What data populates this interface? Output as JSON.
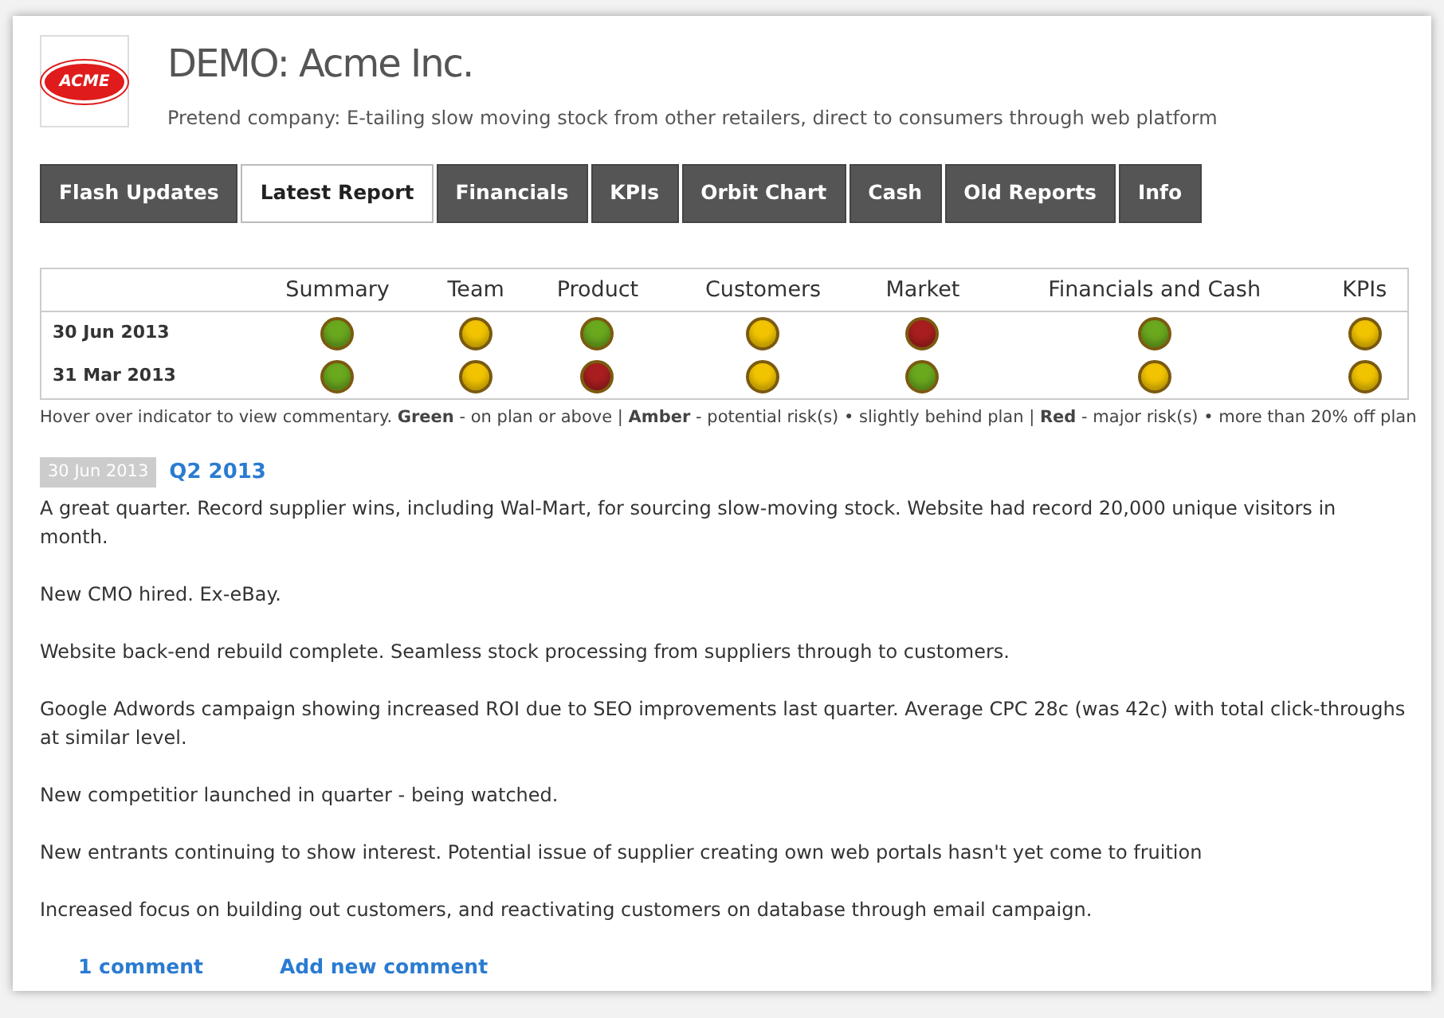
{
  "company": {
    "logo_text": "ACME",
    "title": "DEMO: Acme Inc.",
    "description": "Pretend company: E-tailing slow moving stock from other retailers, direct to consumers through web platform"
  },
  "tabs": [
    {
      "label": "Flash Updates",
      "selected": false
    },
    {
      "label": "Latest Report",
      "selected": true
    },
    {
      "label": "Financials",
      "selected": false
    },
    {
      "label": "KPIs",
      "selected": false
    },
    {
      "label": "Orbit Chart",
      "selected": false
    },
    {
      "label": "Cash",
      "selected": false
    },
    {
      "label": "Old Reports",
      "selected": false
    },
    {
      "label": "Info",
      "selected": false
    }
  ],
  "status_table": {
    "columns": [
      "Summary",
      "Team",
      "Product",
      "Customers",
      "Market",
      "Financials and Cash",
      "KPIs"
    ],
    "rows": [
      {
        "date": "30 Jun 2013",
        "indicators": [
          {
            "color": "#6aa81e"
          },
          {
            "color": "#f2c400"
          },
          {
            "color": "#6aa81e"
          },
          {
            "color": "#f2c400"
          },
          {
            "color": "#a81e1e"
          },
          {
            "color": "#6aa81e"
          },
          {
            "color": "#f2c400"
          }
        ]
      },
      {
        "date": "31 Mar 2013",
        "indicators": [
          {
            "color": "#6aa81e"
          },
          {
            "color": "#f2c400"
          },
          {
            "color": "#a81e1e"
          },
          {
            "color": "#f2c400"
          },
          {
            "color": "#6aa81e"
          },
          {
            "color": "#f2c400"
          },
          {
            "color": "#f2c400"
          }
        ]
      }
    ],
    "legend": "Hover over indicator to view commentary. **Green** - on plan or above | **Amber** - potential risk(s) • slightly behind plan | **Red** - major risk(s) • more than 20% off plan"
  },
  "report": {
    "date": "30 Jun 2013",
    "title": "Q2 2013",
    "paragraphs": [
      "A great quarter. Record supplier wins, including Wal-Mart, for sourcing slow-moving stock. Website had record 20,000 unique visitors in month.",
      "New CMO hired. Ex-eBay.",
      "Website back-end rebuild complete. Seamless stock processing from suppliers through to customers.",
      "Google Adwords campaign showing increased ROI due to SEO improvements last quarter. Average CPC 28c (was 42c) with total click-throughs at similar level.",
      "New competitior launched in quarter - being watched.",
      "New entrants continuing to show interest. Potential issue of supplier creating own web portals hasn't yet come to fruition",
      "Increased focus on building out customers, and reactivating customers on database through email campaign."
    ],
    "links": [
      "1 comment",
      "Add new comment"
    ]
  }
}
